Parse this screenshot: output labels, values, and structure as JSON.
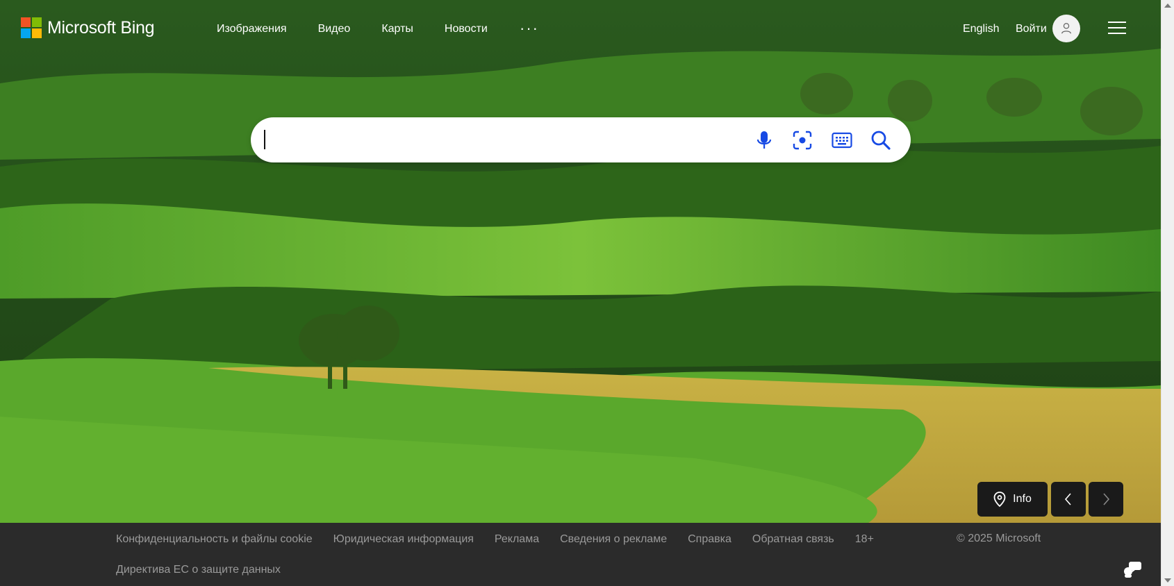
{
  "header": {
    "brand": "Microsoft Bing",
    "logo_colors": [
      "#f35325",
      "#81bc06",
      "#05a6f0",
      "#ffba08"
    ],
    "nav": [
      {
        "label": "Изображения"
      },
      {
        "label": "Видео"
      },
      {
        "label": "Карты"
      },
      {
        "label": "Новости"
      }
    ],
    "more_label": "···",
    "language_link": "English",
    "signin_label": "Войти"
  },
  "search": {
    "placeholder": "",
    "value": "",
    "icons": [
      "microphone-icon",
      "visual-search-icon",
      "keyboard-icon",
      "search-icon"
    ]
  },
  "image_controls": {
    "info_label": "Info",
    "icons": [
      "location-pin-icon",
      "chevron-left-icon",
      "chevron-right-icon"
    ]
  },
  "footer": {
    "links": [
      "Конфиденциальность и файлы cookie",
      "Юридическая информация",
      "Реклама",
      "Сведения о рекламе",
      "Справка",
      "Обратная связь",
      "18+"
    ],
    "second_row_link": "Директива ЕС о защите данных",
    "copyright": "© 2025 Microsoft"
  },
  "colors": {
    "footer_bg": "#2b2b2b",
    "footer_text": "#9a9a9a",
    "control_bg": "#1a1a1a",
    "accent_blue": "#174ae4"
  }
}
